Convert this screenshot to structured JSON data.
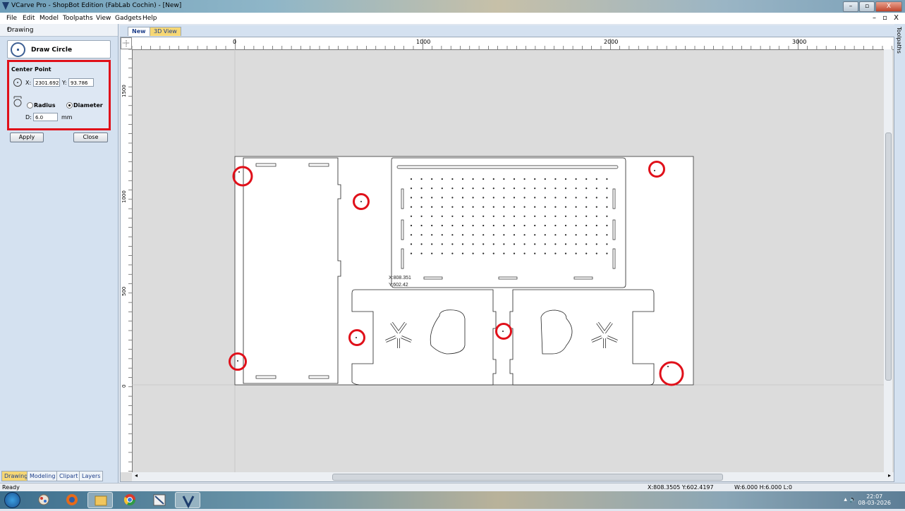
{
  "window": {
    "title": "VCarve Pro - ShopBot Edition (FabLab Cochin) - [New]",
    "buttons": [
      "–",
      "▫",
      "X"
    ]
  },
  "menu": {
    "items": [
      "File",
      "Edit",
      "Model",
      "Toolpaths",
      "View",
      "Gadgets",
      "Help"
    ],
    "mdi_controls": "–  ▫  X"
  },
  "left_panel": {
    "header": "Drawing",
    "pin": "ᵖ",
    "tool_title": "Draw Circle",
    "center_point_label": "Center Point",
    "x_label": "X:",
    "x_value": "2301.692",
    "y_label": "Y:",
    "y_value": "93.786",
    "radius_label": "Radius",
    "diameter_label": "Diameter",
    "selected_mode": "Diameter",
    "d_label": "D:",
    "d_value": "6.0",
    "unit": "mm",
    "apply_label": "Apply",
    "close_label": "Close",
    "tabs": [
      "Drawing",
      "Modeling",
      "Clipart",
      "Layers"
    ],
    "active_tab": "Drawing"
  },
  "doc_tabs": [
    "New",
    "3D View"
  ],
  "active_doc_tab": "New",
  "right_tab": "Toolpaths",
  "rulers": {
    "h_labels": [
      "0",
      "1000",
      "2000",
      "3000"
    ],
    "v_labels": [
      "1500",
      "1000",
      "500",
      "0"
    ]
  },
  "cursor_tooltip": {
    "x": "X:808.351",
    "y": "Y:602.42"
  },
  "status": {
    "left": "Ready",
    "coords": "X:808.3505 Y:602.4197",
    "dims": "W:6.000  H:6.000  L:0"
  },
  "taskbar": {
    "time": "22:07",
    "date": "08-03-2026",
    "apps": [
      "explorer",
      "paint",
      "firefox",
      "files",
      "chrome",
      "vectric",
      "vcarve"
    ]
  },
  "colors": {
    "highlight_red": "#e0101a",
    "panel_bg": "#d4e1f0",
    "canvas_bg": "#dcdcdc",
    "active_tab": "#f6d774"
  }
}
